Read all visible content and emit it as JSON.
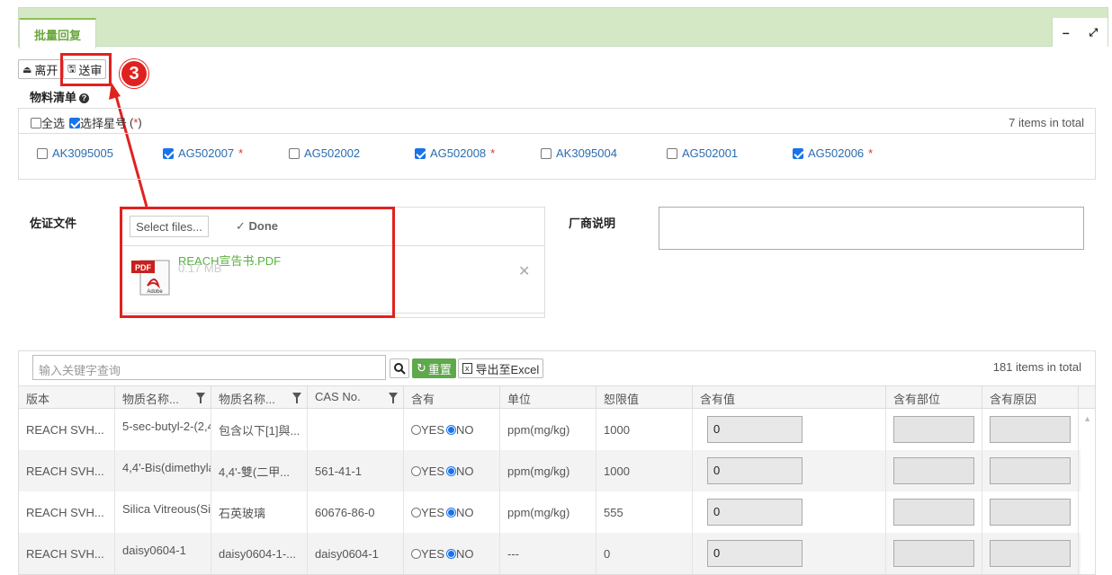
{
  "tab": {
    "title": "批量回复",
    "minimize": "–",
    "expand": "⤢"
  },
  "toolbar": {
    "leave": "离开",
    "submit": "送审"
  },
  "annotation": {
    "step": "3"
  },
  "materials": {
    "title": "物料清单",
    "select_all": "全选",
    "select_star_pre": "选择星号",
    "select_star_open": "(",
    "select_star_mark": "*",
    "select_star_close": ")",
    "total": "7  items in total",
    "items": [
      {
        "code": "AK3095005",
        "checked": false,
        "star": ""
      },
      {
        "code": "AG502007",
        "checked": true,
        "star": "*"
      },
      {
        "code": "AG502002",
        "checked": false,
        "star": ""
      },
      {
        "code": "AG502008",
        "checked": true,
        "star": "*"
      },
      {
        "code": "AK3095004",
        "checked": false,
        "star": ""
      },
      {
        "code": "AG502001",
        "checked": false,
        "star": ""
      },
      {
        "code": "AG502006",
        "checked": true,
        "star": "*"
      }
    ]
  },
  "files": {
    "label": "佐证文件",
    "select": "Select files...",
    "done": "Done",
    "file_name": "REACH宣告书.PDF",
    "file_size": "0.17 MB",
    "pdf_label": "PDF",
    "pdf_brand": "Adobe"
  },
  "vendor": {
    "label": "厂商说明"
  },
  "grid": {
    "search_placeholder": "输入关键字查询",
    "reset": "重置",
    "export": "导出至Excel",
    "total": "181 items in total",
    "columns": [
      "版本",
      "物质名称...",
      "物质名称...",
      "CAS No.",
      "含有",
      "单位",
      "恕限值",
      "含有值",
      "含有部位",
      "含有原因"
    ],
    "rows": [
      {
        "version": "REACH SVH...",
        "name_en": "5-sec-butyl-2-(2,4",
        "name_cn": "包含以下[1]與...",
        "cas": "",
        "yes": "YES",
        "no": "NO",
        "unit": "ppm(mg/kg)",
        "limit": "1000",
        "value": "0"
      },
      {
        "version": "REACH SVH...",
        "name_en": "4,4'-Bis(dimethyla",
        "name_cn": "4,4'-雙(二甲...",
        "cas": "561-41-1",
        "yes": "YES",
        "no": "NO",
        "unit": "ppm(mg/kg)",
        "limit": "1000",
        "value": "0"
      },
      {
        "version": "REACH SVH...",
        "name_en": "Silica Vitreous(Si(",
        "name_cn": "石英玻璃",
        "cas": "60676-86-0",
        "yes": "YES",
        "no": "NO",
        "unit": "ppm(mg/kg)",
        "limit": "555",
        "value": "0"
      },
      {
        "version": "REACH SVH...",
        "name_en": "daisy0604-1",
        "name_cn": "daisy0604-1-...",
        "cas": "daisy0604-1",
        "yes": "YES",
        "no": "NO",
        "unit": "---",
        "limit": "0",
        "value": "0"
      }
    ]
  },
  "colors": {
    "accent_green": "#8cbf54",
    "highlight_red": "#e0221f",
    "link_blue": "#2b6cb0"
  }
}
